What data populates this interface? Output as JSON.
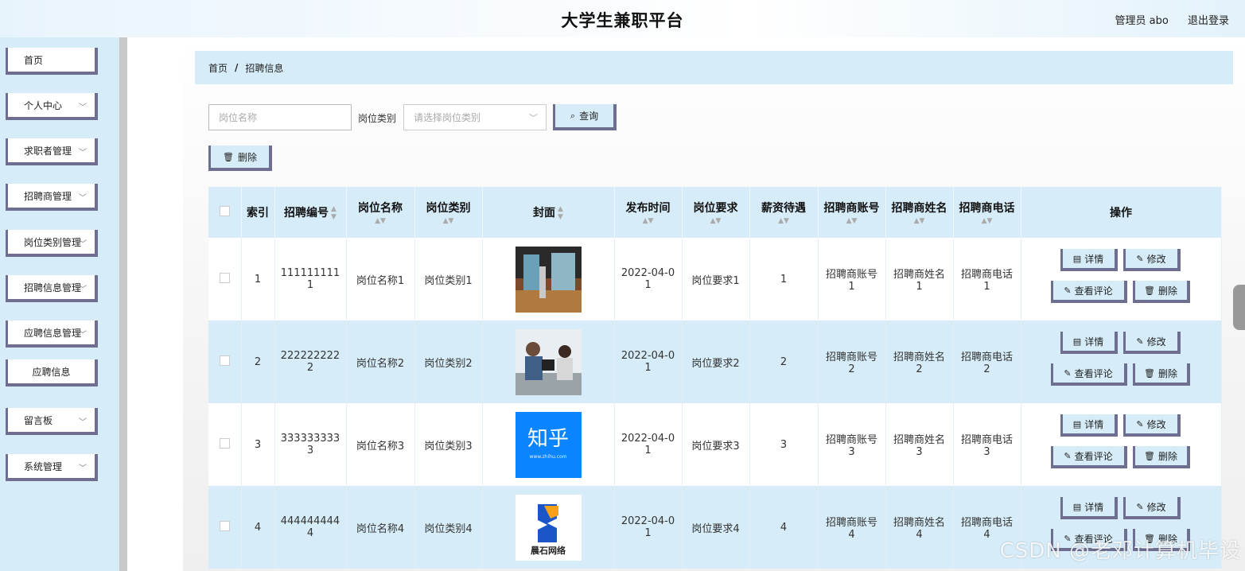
{
  "header": {
    "title": "大学生兼职平台",
    "admin": "管理员 abo",
    "logout": "退出登录"
  },
  "sidebar": {
    "items": [
      {
        "label": "首页",
        "chevron": false
      },
      {
        "label": "个人中心",
        "chevron": true
      },
      {
        "label": "求职者管理",
        "chevron": true
      },
      {
        "label": "招聘商管理",
        "chevron": true
      },
      {
        "label": "岗位类别管理",
        "chevron": true
      },
      {
        "label": "招聘信息管理",
        "chevron": true
      },
      {
        "label": "应聘信息管理",
        "chevron": true
      },
      {
        "label": "应聘信息",
        "chevron": false,
        "sub": true
      },
      {
        "label": "留言板",
        "chevron": true
      },
      {
        "label": "系统管理",
        "chevron": true
      }
    ]
  },
  "breadcrumb": {
    "home": "首页",
    "sep": "/",
    "current": "招聘信息"
  },
  "filters": {
    "name_placeholder": "岗位名称",
    "category_label": "岗位类别",
    "category_placeholder": "请选择岗位类别",
    "query_label": "查询",
    "delete_label": "删除"
  },
  "table": {
    "headers": {
      "index": "索引",
      "code": "招聘编号",
      "name": "岗位名称",
      "category": "岗位类别",
      "cover": "封面",
      "time": "发布时间",
      "req": "岗位要求",
      "salary": "薪资待遇",
      "acct": "招聘商账号",
      "person": "招聘商姓名",
      "phone": "招聘商电话",
      "ops": "操作"
    },
    "rows": [
      {
        "index": "1",
        "code": "1111111111",
        "name": "岗位名称1",
        "category": "岗位类别1",
        "time": "2022-04-01",
        "req": "岗位要求1",
        "salary": "1",
        "acct": "招聘商账号1",
        "person": "招聘商姓名1",
        "phone": "招聘商电话1"
      },
      {
        "index": "2",
        "code": "2222222222",
        "name": "岗位名称2",
        "category": "岗位类别2",
        "time": "2022-04-01",
        "req": "岗位要求2",
        "salary": "2",
        "acct": "招聘商账号2",
        "person": "招聘商姓名2",
        "phone": "招聘商电话2"
      },
      {
        "index": "3",
        "code": "3333333333",
        "name": "岗位名称3",
        "category": "岗位类别3",
        "time": "2022-04-01",
        "req": "岗位要求3",
        "salary": "3",
        "acct": "招聘商账号3",
        "person": "招聘商姓名3",
        "phone": "招聘商电话3",
        "cover_text": "知乎"
      },
      {
        "index": "4",
        "code": "4444444444",
        "name": "岗位名称4",
        "category": "岗位类别4",
        "time": "2022-04-01",
        "req": "岗位要求4",
        "salary": "4",
        "acct": "招聘商账号4",
        "person": "招聘商姓名4",
        "phone": "招聘商电话4",
        "cover_text": "晨石网络"
      }
    ],
    "actions": {
      "detail": "详情",
      "edit": "修改",
      "review": "查看评论",
      "delete": "删除"
    }
  },
  "watermark": "CSDN @老邓计算机毕设"
}
